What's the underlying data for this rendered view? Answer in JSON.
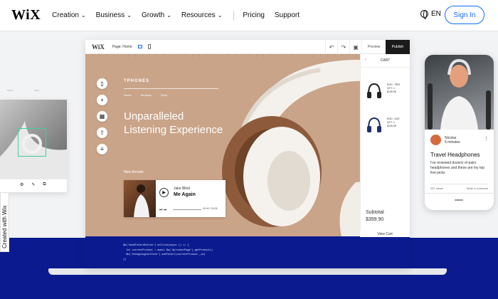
{
  "nav": {
    "logo": "WiX",
    "items": [
      {
        "label": "Creation"
      },
      {
        "label": "Business"
      },
      {
        "label": "Growth"
      },
      {
        "label": "Resources"
      }
    ],
    "links": [
      "Pricing",
      "Support"
    ],
    "language": "EN",
    "signin": "Sign In"
  },
  "editor": {
    "logo": "WiX",
    "page_select": "Page: Home",
    "preview": "Preview",
    "publish": "Publish",
    "site": {
      "name": "TPHONES",
      "nav": [
        "Home",
        "Reviews",
        "Shop"
      ],
      "hero": [
        "Unparalleled",
        "Listening Experience"
      ],
      "new_arrivals": "New Arrivals"
    },
    "player": {
      "artist": "Jake Blind",
      "song": "Me Again",
      "time": "00:00 / 03:08"
    },
    "cart": {
      "title": "CART",
      "items": [
        {
          "name": "ENO - PRO",
          "qty": "QTY: 1",
          "price": "$199.95"
        },
        {
          "name": "ENO - ACE",
          "qty": "QTY: 1",
          "price": "$199.95"
        }
      ],
      "subtotal_label": "Subtotal",
      "subtotal_value": "$399.90",
      "view_cart": "View Cart"
    },
    "code": [
      "$w('#addToCartButton').onClick(async () => {",
      "  let currentProduct = await $w('#productPage').getProduct()",
      "  $w('#shoppingCartIcon').addToCart(currentProduct._id)",
      "})"
    ]
  },
  "left_panel": {
    "grid_labels": [
      "Lorem",
      "Price"
    ]
  },
  "created_with": "Created with Wix",
  "phone": {
    "author": "Nicolas",
    "read_time": "5 minutes",
    "title": "Travel Headphones",
    "desc": "I've reviewed dozens of pairs headphones and these are my top five picks",
    "views": "257 views",
    "comment": "Write a comment"
  },
  "colors": {
    "accent": "#116dff",
    "band": "#0b1b8f",
    "canvas": "#c9a489"
  }
}
